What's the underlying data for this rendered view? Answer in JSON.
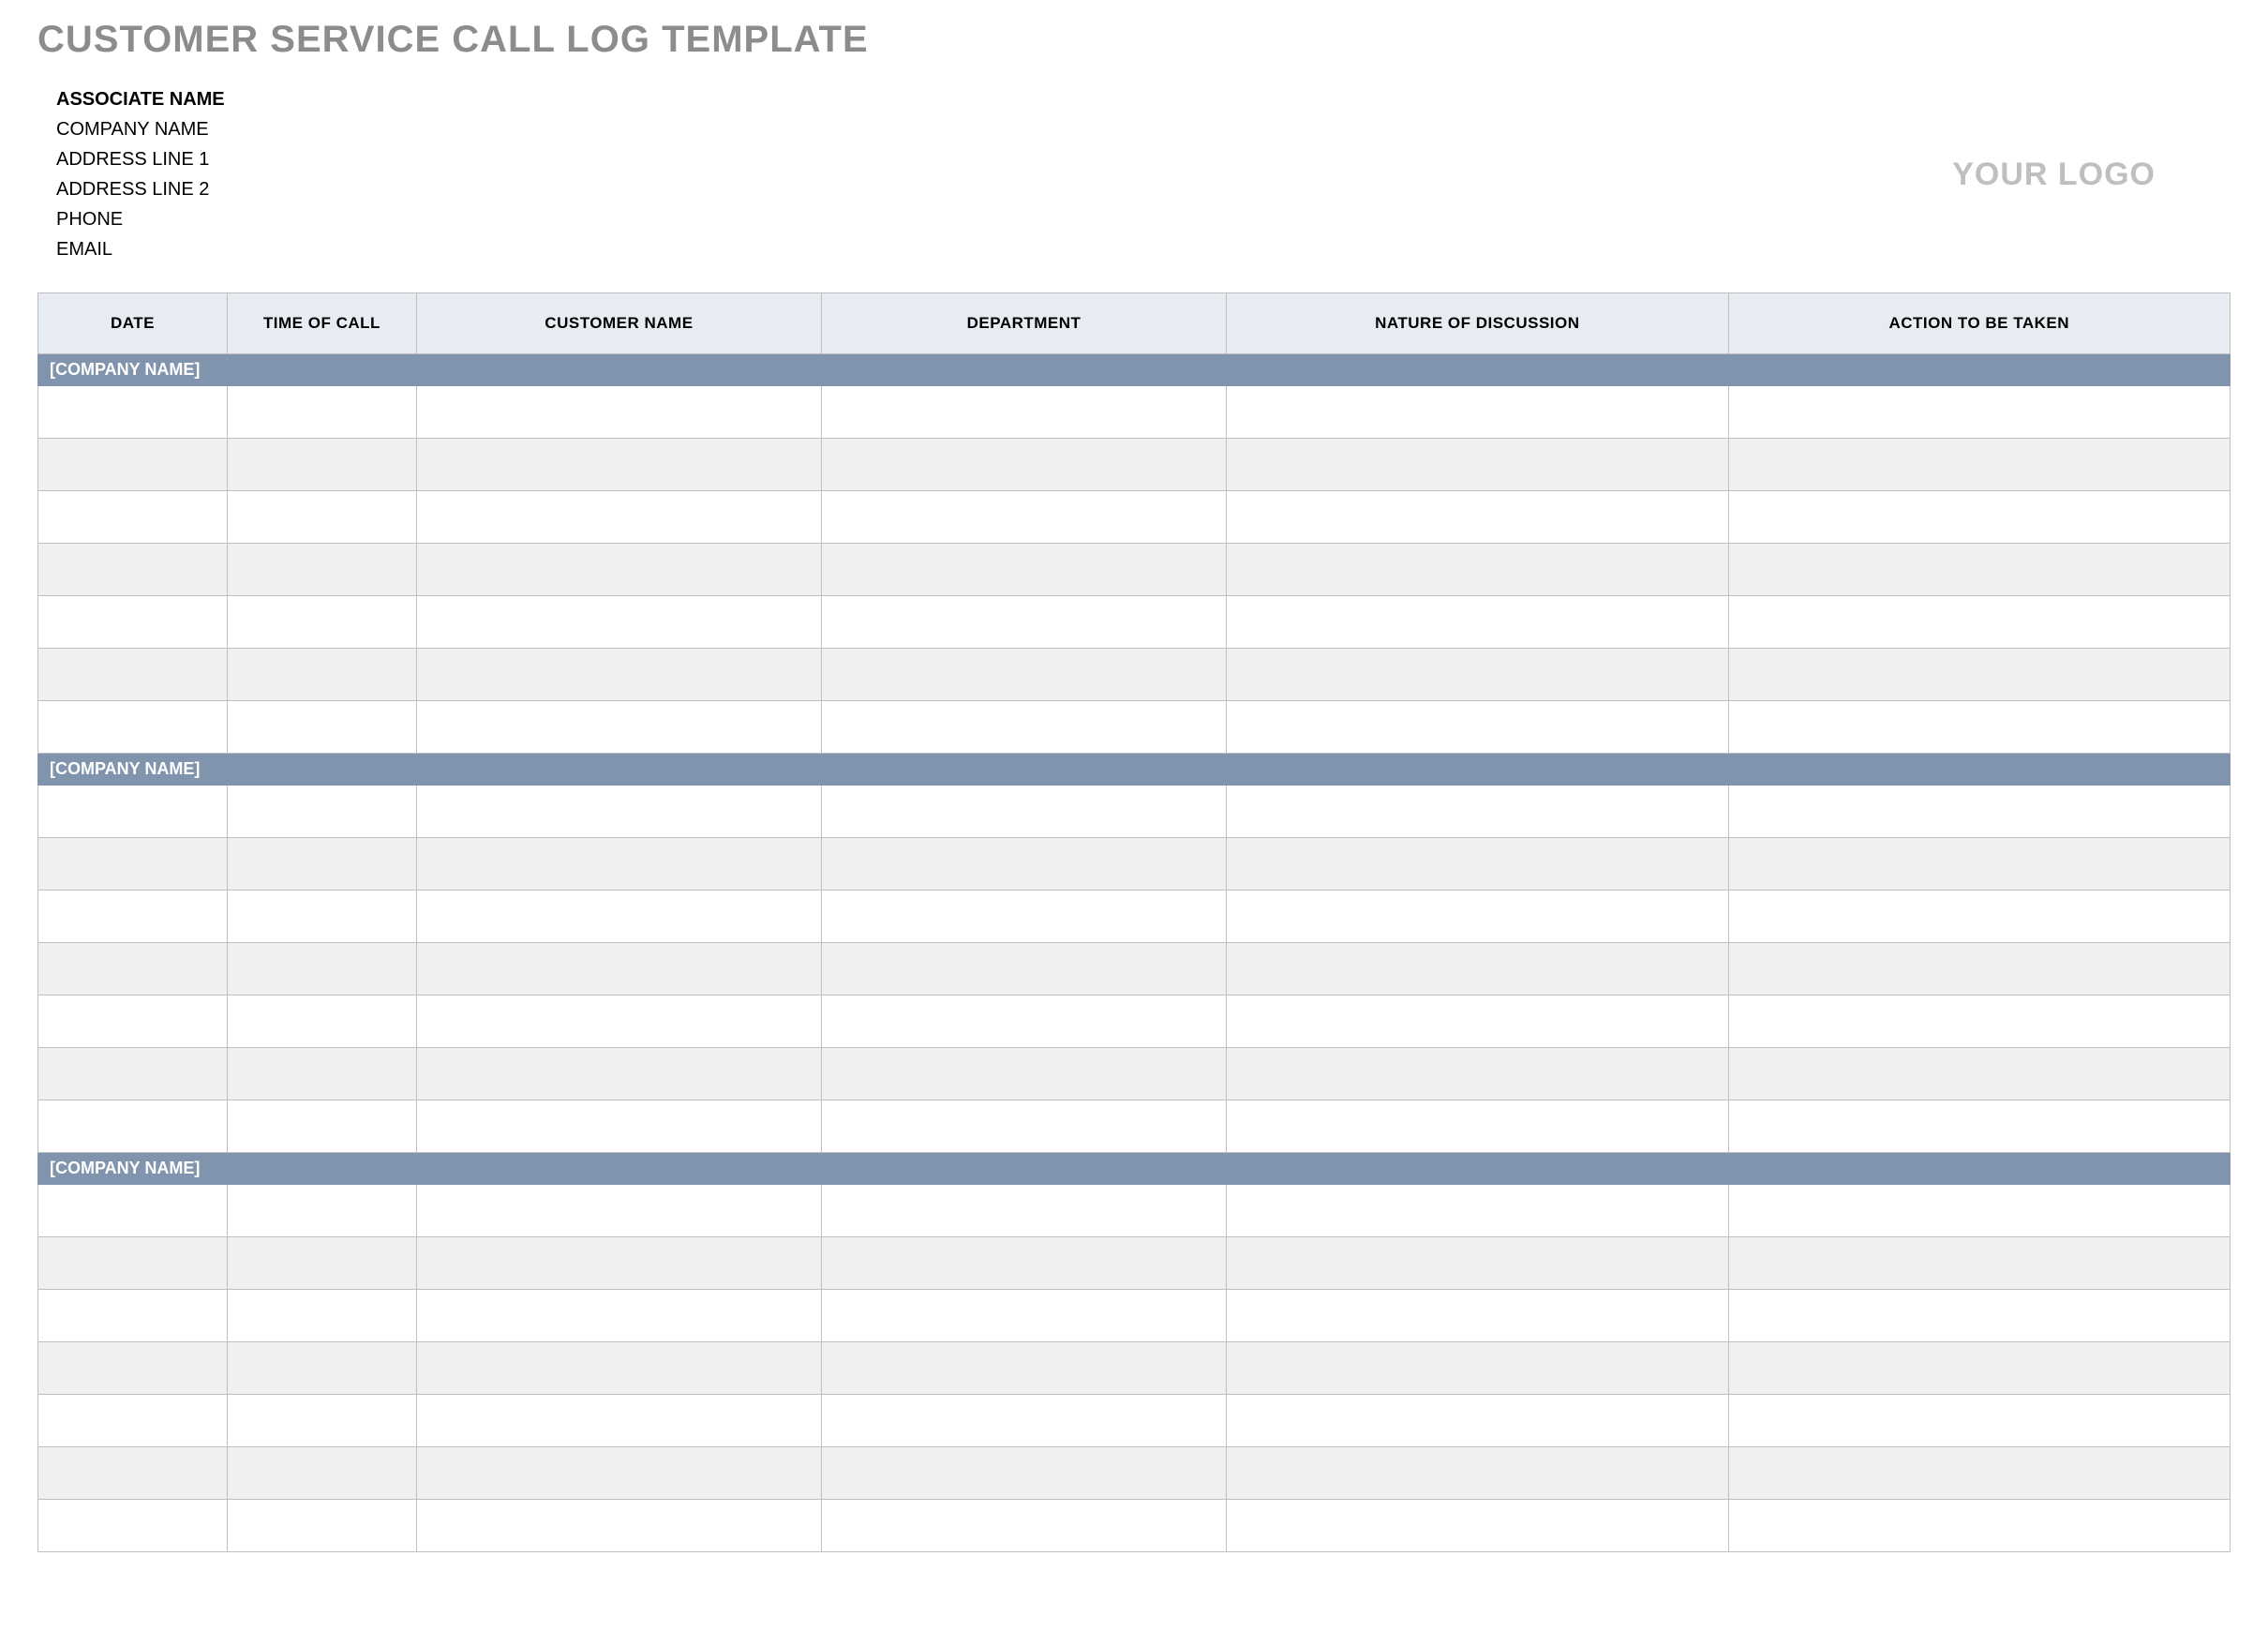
{
  "title": "CUSTOMER SERVICE CALL LOG TEMPLATE",
  "info": {
    "associate_label": "ASSOCIATE NAME",
    "company_label": "COMPANY NAME",
    "address1_label": "ADDRESS LINE 1",
    "address2_label": "ADDRESS LINE 2",
    "phone_label": "PHONE",
    "email_label": "EMAIL"
  },
  "logo_placeholder": "YOUR LOGO",
  "columns": {
    "date": "DATE",
    "time": "TIME OF CALL",
    "customer": "CUSTOMER NAME",
    "department": "DEPARTMENT",
    "nature": "NATURE OF DISCUSSION",
    "action": "ACTION TO BE TAKEN"
  },
  "sections": [
    {
      "label": "[COMPANY NAME]",
      "rows": [
        "",
        "",
        "",
        "",
        "",
        "",
        ""
      ]
    },
    {
      "label": "[COMPANY NAME]",
      "rows": [
        "",
        "",
        "",
        "",
        "",
        "",
        ""
      ]
    },
    {
      "label": "[COMPANY NAME]",
      "rows": [
        "",
        "",
        "",
        "",
        "",
        "",
        ""
      ]
    }
  ]
}
